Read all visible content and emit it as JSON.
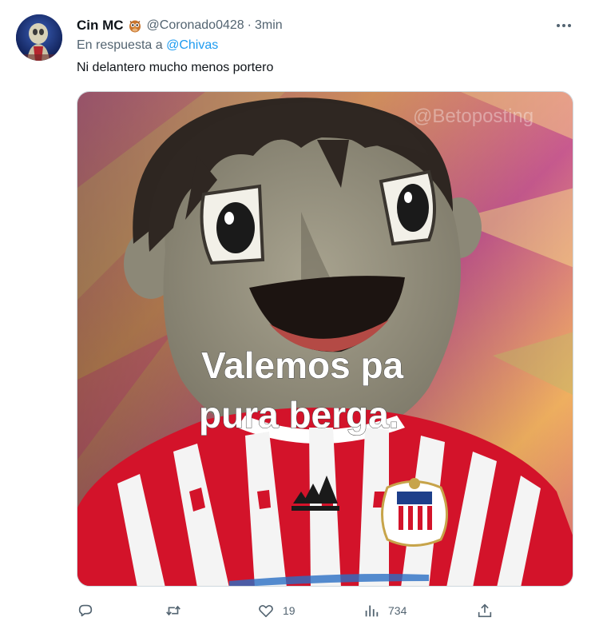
{
  "tweet": {
    "author_name": "Cin MC",
    "author_emoji": "owl-emoji",
    "handle": "@Coronado0428",
    "separator": "·",
    "time": "3min",
    "reply_prefix": "En respuesta a",
    "reply_mention": "@Chivas",
    "text": "Ni delantero mucho menos portero"
  },
  "media": {
    "caption_line1": "Valemos pa",
    "caption_line2": "pura berga.",
    "watermark": "@Betoposting"
  },
  "actions": {
    "reply": {
      "icon": "reply-icon",
      "count": ""
    },
    "retweet": {
      "icon": "retweet-icon",
      "count": ""
    },
    "like": {
      "icon": "heart-icon",
      "count": "19"
    },
    "views": {
      "icon": "views-icon",
      "count": "734"
    },
    "share": {
      "icon": "share-icon",
      "count": ""
    }
  },
  "colors": {
    "text_primary": "#0f1419",
    "text_secondary": "#536471",
    "link": "#1d9bf0",
    "jersey_red": "#d3132a"
  }
}
